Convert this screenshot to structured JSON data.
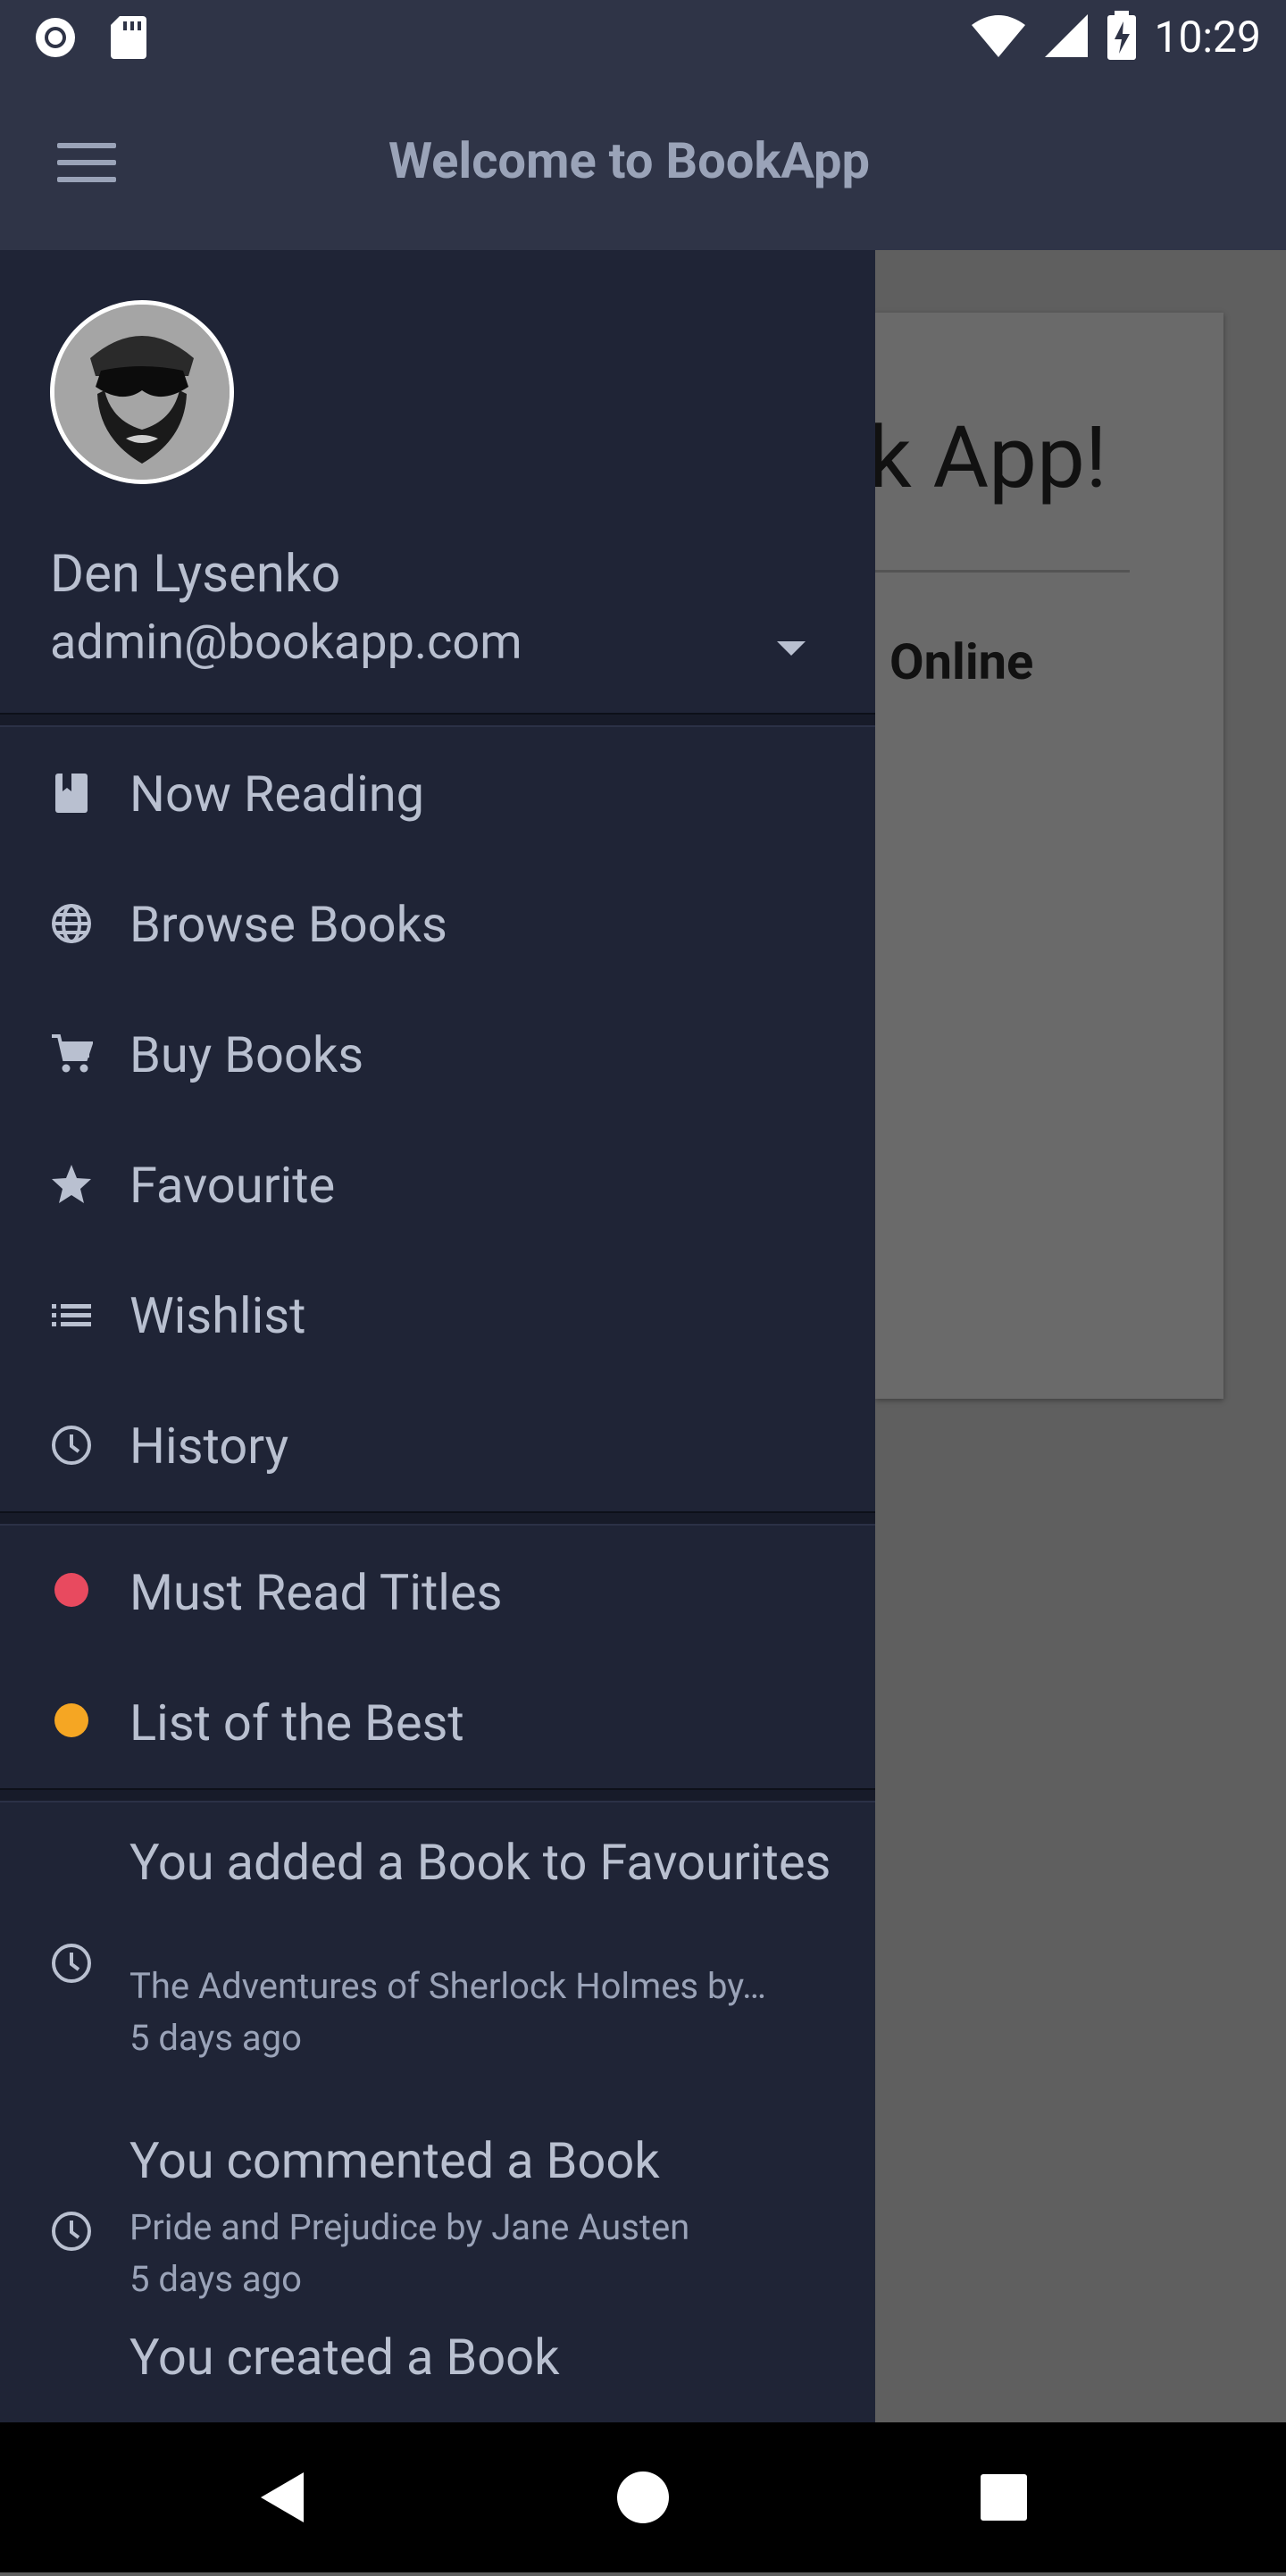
{
  "status_bar": {
    "time": "10:29",
    "left_icons": [
      "circle-notification-icon",
      "sd-card-icon"
    ],
    "right_icons": [
      "wifi-icon",
      "cellular-signal-icon",
      "battery-charging-icon"
    ]
  },
  "app_bar": {
    "title": "Welcome to BookApp",
    "menu_icon": "hamburger-menu-icon"
  },
  "background_card": {
    "headline": "k App!",
    "subtext": "Online"
  },
  "drawer": {
    "account": {
      "name": "Den Lysenko",
      "email": "admin@bookapp.com"
    },
    "nav_items": [
      {
        "label": "Now Reading",
        "icon": "book-icon"
      },
      {
        "label": "Browse Books",
        "icon": "globe-icon"
      },
      {
        "label": "Buy Books",
        "icon": "cart-icon"
      },
      {
        "label": "Favourite",
        "icon": "star-icon"
      },
      {
        "label": "Wishlist",
        "icon": "list-icon"
      },
      {
        "label": "History",
        "icon": "clock-icon"
      }
    ],
    "label_items": [
      {
        "label": "Must Read Titles",
        "color": "#e84a5f"
      },
      {
        "label": "List of the Best",
        "color": "#f5a623"
      }
    ],
    "activity": [
      {
        "title": "You added a Book to Favourites",
        "subtitle": "The Adventures of Sherlock Holmes by…",
        "time": "5 days ago"
      },
      {
        "title": "You commented a Book",
        "subtitle": "Pride and Prejudice by Jane Austen",
        "time": "5 days ago"
      },
      {
        "title": "You created a Book"
      }
    ]
  },
  "colors": {
    "app_bar": "#2f3447",
    "drawer": "#1f2436",
    "text": "#b9c0d0",
    "scrim": "#5f5f5f"
  },
  "nav_bar": {
    "buttons": [
      "back-icon",
      "home-icon",
      "recents-icon"
    ]
  }
}
